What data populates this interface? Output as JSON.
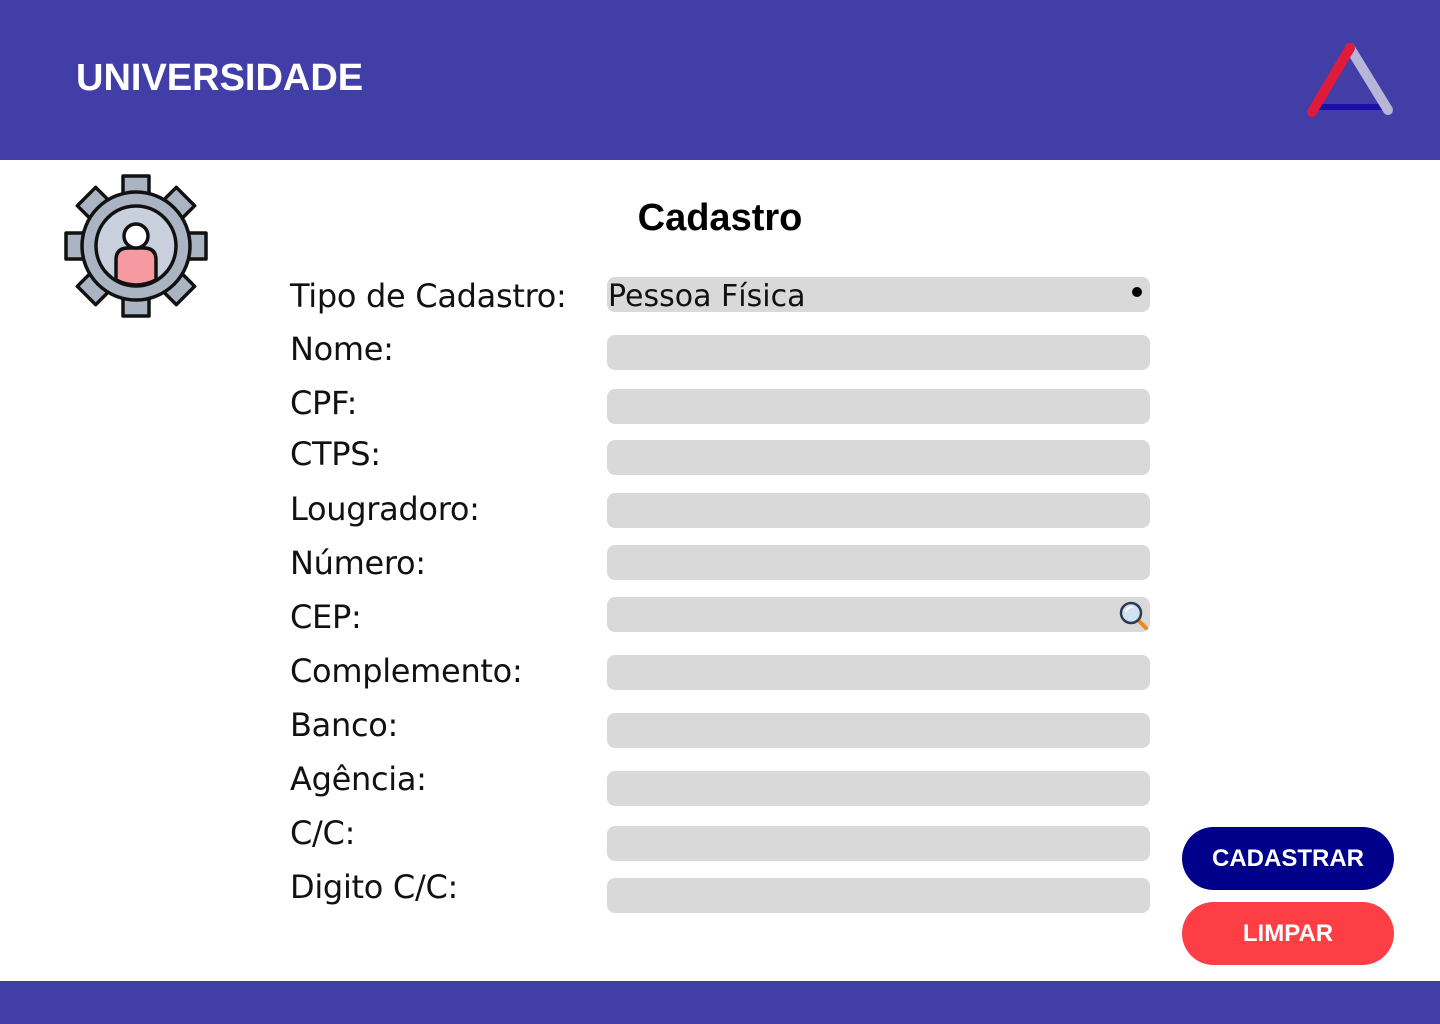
{
  "header": {
    "brand": "UNIVERSIDADE"
  },
  "page": {
    "title": "Cadastro"
  },
  "form": {
    "tipo_label": "Tipo de Cadastro:",
    "tipo_value": "Pessoa Física",
    "fields": [
      {
        "label": "Nome:",
        "value": ""
      },
      {
        "label": "CPF:",
        "value": ""
      },
      {
        "label": "CTPS:",
        "value": ""
      },
      {
        "label": "Lougradoro:",
        "value": ""
      },
      {
        "label": "Número:",
        "value": ""
      },
      {
        "label": "CEP:",
        "value": ""
      },
      {
        "label": "Complemento:",
        "value": ""
      },
      {
        "label": "Banco:",
        "value": ""
      },
      {
        "label": "Agência:",
        "value": ""
      },
      {
        "label": "C/C:",
        "value": ""
      },
      {
        "label": "Digito C/C:",
        "value": ""
      }
    ]
  },
  "buttons": {
    "submit": "CADASTRAR",
    "clear": "LIMPAR"
  },
  "icons": {
    "logo": "triangle-logo-icon",
    "gear": "user-settings-gear-icon",
    "search": "search-icon"
  },
  "colors": {
    "header": "#423ea8",
    "primary": "#01008a",
    "danger": "#fd3f45",
    "field": "#d9d9d9"
  }
}
